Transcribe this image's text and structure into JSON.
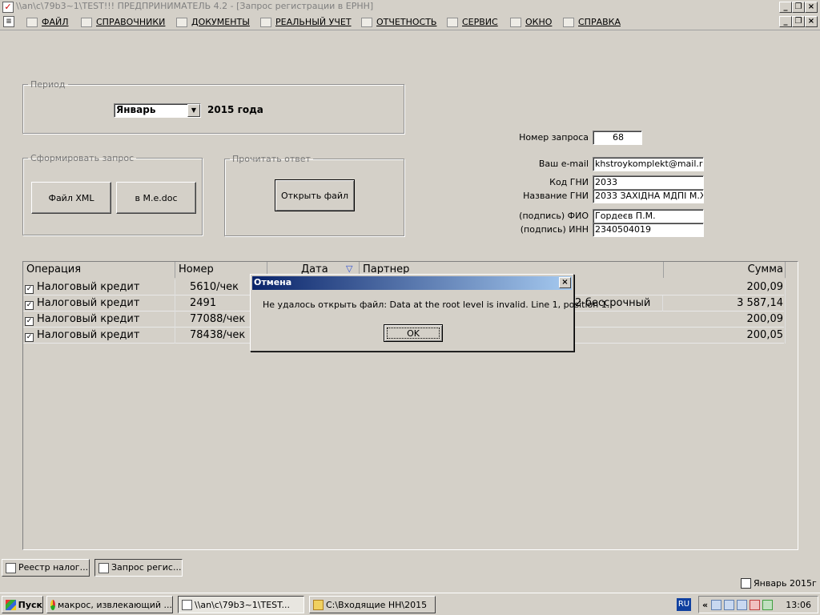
{
  "window": {
    "title": "\\\\an\\c\\79b3~1\\TEST!!!  ПРЕДПРИНИМАТЕЛЬ 4.2 - [Запрос регистрации в ЕРНН]",
    "icon": "check-app-icon"
  },
  "menu": {
    "items": [
      "ФАЙЛ",
      "СПРАВОЧНИКИ",
      "ДОКУМЕНТЫ",
      "РЕАЛЬНЫЙ УЧЕТ",
      "ОТЧЕТНОСТЬ",
      "СЕРВИС",
      "ОКНО",
      "СПРАВКА"
    ]
  },
  "period": {
    "legend": "Период",
    "month": "Январь",
    "year_text": "2015 года"
  },
  "form_request": {
    "legend": "Сформировать запрос",
    "btn_xml": "Файл XML",
    "btn_medoc": "в M.e.doc"
  },
  "read_reply": {
    "legend": "Прочитать ответ",
    "btn_open": "Открыть файл"
  },
  "fields": {
    "request_no": {
      "label": "Номер запроса",
      "value": "68"
    },
    "email": {
      "label": "Ваш e-mail",
      "value": "khstroykomplekt@mail.ru"
    },
    "gni_code": {
      "label": "Код ГНИ",
      "value": "2033"
    },
    "gni_name": {
      "label": "Название ГНИ",
      "value": "2033 ЗАХІДНА МДПІ М.Х"
    },
    "fio": {
      "label": "(подпись) ФИО",
      "value": "Гордеєв П.М."
    },
    "inn": {
      "label": "(подпись) ИНН",
      "value": "2340504019"
    }
  },
  "grid": {
    "headers": {
      "op": "Операция",
      "num": "Номер",
      "date": "Дата",
      "partner": "Партнер",
      "sum": "Сумма"
    },
    "rows": [
      {
        "op": "Налоговый кредит",
        "num": "5610/чек",
        "partner": "",
        "sum": "200,09"
      },
      {
        "op": "Налоговый кредит",
        "num": "2491",
        "partner": "2-бессрочный",
        "sum": "3 587,14"
      },
      {
        "op": "Налоговый кредит",
        "num": "77088/чек",
        "partner": "",
        "sum": "200,09"
      },
      {
        "op": "Налоговый кредит",
        "num": "78438/чек",
        "partner": "",
        "sum": "200,05"
      }
    ]
  },
  "dialog": {
    "title": "Отмена",
    "message": "Не удалось открыть файл: Data at the root level is invalid. Line 1, position 1.",
    "ok": "OK"
  },
  "tabs": [
    "Реестр налог...",
    "Запрос регис..."
  ],
  "status": {
    "period": "Январь 2015г"
  },
  "taskbar": {
    "start": "Пуск",
    "items": [
      "макрос, извлекающий ...",
      "\\\\an\\c\\79b3~1\\TEST...",
      "C:\\Входящие НН\\2015"
    ],
    "lang": "RU",
    "time": "13:06"
  }
}
